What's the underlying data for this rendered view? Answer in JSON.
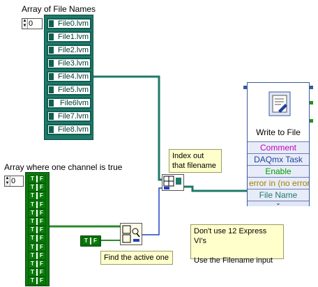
{
  "labels": {
    "file_names_array": "Array of File Names",
    "bool_array": "Array where one channel is true"
  },
  "file_array": {
    "index": "0",
    "items": [
      "File0.lvm",
      "File1.lvm",
      "File2.lvm",
      "File3.lvm",
      "File4.lvm",
      "File5.lvm",
      "File6lvm",
      "File7.lvm",
      "File8.lvm"
    ]
  },
  "bool_array": {
    "index": "0",
    "items": [
      [
        "T",
        "F"
      ],
      [
        "T",
        "F"
      ],
      [
        "T",
        "F"
      ],
      [
        "T",
        "F"
      ],
      [
        "T",
        "F"
      ],
      [
        "T",
        "F"
      ],
      [
        "T",
        "F"
      ],
      [
        "T",
        "F"
      ],
      [
        "T",
        "F"
      ],
      [
        "T",
        "F"
      ],
      [
        "T",
        "F"
      ],
      [
        "T",
        "F"
      ],
      [
        "T",
        "F"
      ]
    ]
  },
  "bool_constant": {
    "a": "T",
    "b": "F"
  },
  "notes": {
    "index_out": "Index out\nthat filename",
    "find_active": "Find the active one",
    "dont_use": "Don't use 12 Express VI's\n\nUse the Filename input"
  },
  "express_vi": {
    "title": "Write to File",
    "rows": [
      "Comment",
      "DAQmx Task",
      "Enable",
      "error in (no error)",
      "File Name"
    ],
    "row_colors": [
      "#c000c0",
      "#2040a0",
      "#00a000",
      "#a08000",
      "#1e7a6a"
    ]
  },
  "colors": {
    "path_wire": "#1e7a6a",
    "bool_wire": "#2a8a2a",
    "int_wire": "#2040c0"
  }
}
